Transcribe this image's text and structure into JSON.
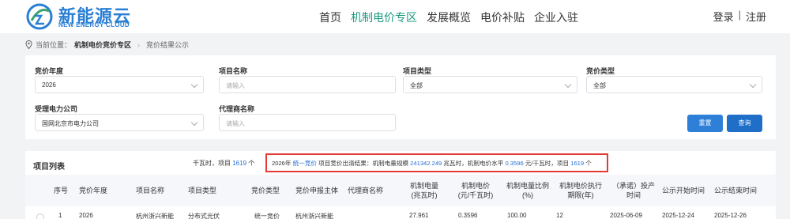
{
  "brand": {
    "name_cn": "新能源云",
    "name_en": "NEW ENERGY CLOUD"
  },
  "nav": [
    "首页",
    "机制电价专区",
    "发展概览",
    "电价补贴",
    "企业入驻"
  ],
  "auth": {
    "login": "登录",
    "sep": "|",
    "register": "注册"
  },
  "breadcrumb": {
    "prefix": "当前位置：",
    "section": "机制电价竞价专区",
    "arrow": "›",
    "page": "竞价结果公示"
  },
  "filters": {
    "year": {
      "label": "竞价年度",
      "value": "2026"
    },
    "project_name": {
      "label": "项目名称",
      "placeholder": "请输入"
    },
    "project_type": {
      "label": "项目类型",
      "value": "全部"
    },
    "bid_type": {
      "label": "竞价类型",
      "value": "全部"
    },
    "power_company": {
      "label": "受理电力公司",
      "value": "国网北京市电力公司"
    },
    "agent": {
      "label": "代理商名称",
      "placeholder": "请输入"
    }
  },
  "buttons": {
    "reset": "重置",
    "query": "查询"
  },
  "results": {
    "title": "项目列表",
    "summary_left": {
      "unit": "千瓦时，项目",
      "count": "1619",
      "suffix": "个"
    },
    "summary": {
      "year": "2026年",
      "bid_type": "统一竞价",
      "t1": "项目竞价出清结果：机制电量规模",
      "scale": "241342.249",
      "t2": "兆瓦时，机制电价水平",
      "price": "0.3596",
      "t3": "元/千瓦时，项目",
      "count": "1619",
      "t4": "个"
    },
    "columns": [
      "序号",
      "竞价年度",
      "项目名称",
      "项目类型",
      "竞价类型",
      "竞价申报主体",
      "代理商名称",
      "机制电量(兆瓦时)",
      "机制电价(元/千瓦时)",
      "机制电量比例(%)",
      "机制电价执行期限(年)",
      "（承诺）投产时间",
      "公示开始时间",
      "公示结束时间"
    ],
    "columns_display": [
      [
        "序号"
      ],
      [
        "竞价年度"
      ],
      [
        "项目名称"
      ],
      [
        "项目类型"
      ],
      [
        "竞价类型"
      ],
      [
        "竞价申报主体"
      ],
      [
        "代理商名称"
      ],
      [
        "机制电量",
        "(兆瓦时)"
      ],
      [
        "机制电价",
        "(元/千瓦时)"
      ],
      [
        "机制电量比例",
        "(%)"
      ],
      [
        "机制电价执行",
        "期限(年)"
      ],
      [
        "（承诺）投产",
        "时间"
      ],
      [
        "公示开始时间"
      ],
      [
        "公示结束时间"
      ]
    ],
    "rows": [
      [
        "1",
        "2026",
        "杭州浙兴新能",
        "分布式光伏",
        "统一竞价",
        "杭州浙兴新能",
        "",
        "27.961",
        "0.3596",
        "100.00",
        "12",
        "2025-06-09",
        "2025-12-24",
        "2025-12-26"
      ]
    ]
  },
  "colors": {
    "brand": "#2a7fd4",
    "nav_active": "#1a9a82",
    "highlight": "#e53935",
    "link": "#2a6fd0",
    "button": "#2d7fd8"
  }
}
